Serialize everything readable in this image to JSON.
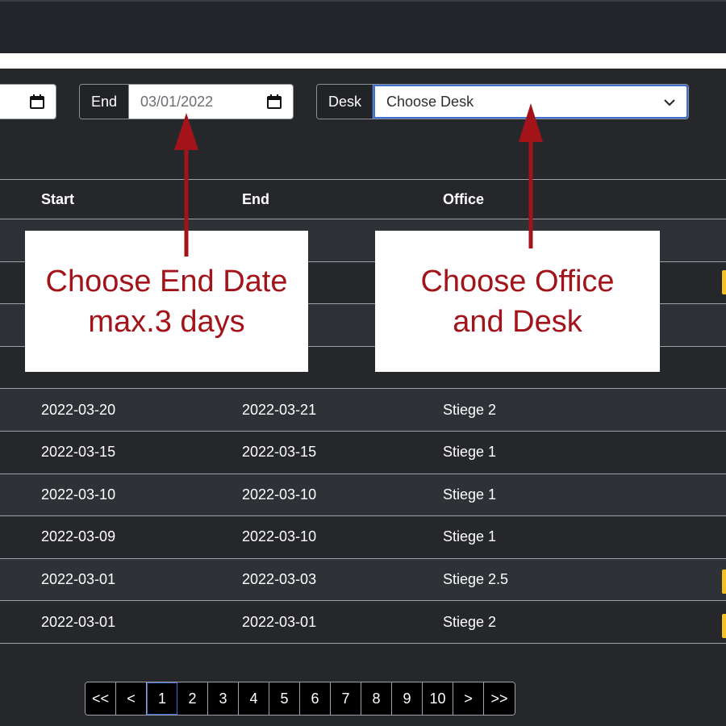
{
  "filters": {
    "end_label": "End",
    "end_value": "03/01/2022",
    "desk_label": "Desk",
    "desk_value": "Choose Desk"
  },
  "table": {
    "headers": [
      "Start",
      "End",
      "Office"
    ],
    "rows": [
      {
        "start": "",
        "end": "",
        "office": ""
      },
      {
        "start": "",
        "end": "",
        "office": ""
      },
      {
        "start": "",
        "end": "",
        "office": ""
      },
      {
        "start": "",
        "end": "",
        "office": ""
      },
      {
        "start": "2022-03-20",
        "end": "2022-03-21",
        "office": "Stiege 2"
      },
      {
        "start": "2022-03-15",
        "end": "2022-03-15",
        "office": "Stiege 1"
      },
      {
        "start": "2022-03-10",
        "end": "2022-03-10",
        "office": "Stiege 1"
      },
      {
        "start": "2022-03-09",
        "end": "2022-03-10",
        "office": "Stiege 1"
      },
      {
        "start": "2022-03-01",
        "end": "2022-03-03",
        "office": "Stiege 2.5"
      },
      {
        "start": "2022-03-01",
        "end": "2022-03-01",
        "office": "Stiege 2"
      }
    ]
  },
  "annotations": {
    "end_line1": "Choose End Date",
    "end_line2": "max.3 days",
    "office_line1": "Choose Office",
    "office_line2": "and Desk",
    "color": "#a3141a"
  },
  "pagination": {
    "first": "<<",
    "prev": "<",
    "pages": [
      "1",
      "2",
      "3",
      "4",
      "5",
      "6",
      "7",
      "8",
      "9",
      "10"
    ],
    "next": ">",
    "last": ">>",
    "active_page": "1"
  },
  "colors": {
    "background": "#25272b",
    "row_alt": "#2e3136",
    "focus": "#3b6fd6",
    "badge": "#f2c023"
  }
}
